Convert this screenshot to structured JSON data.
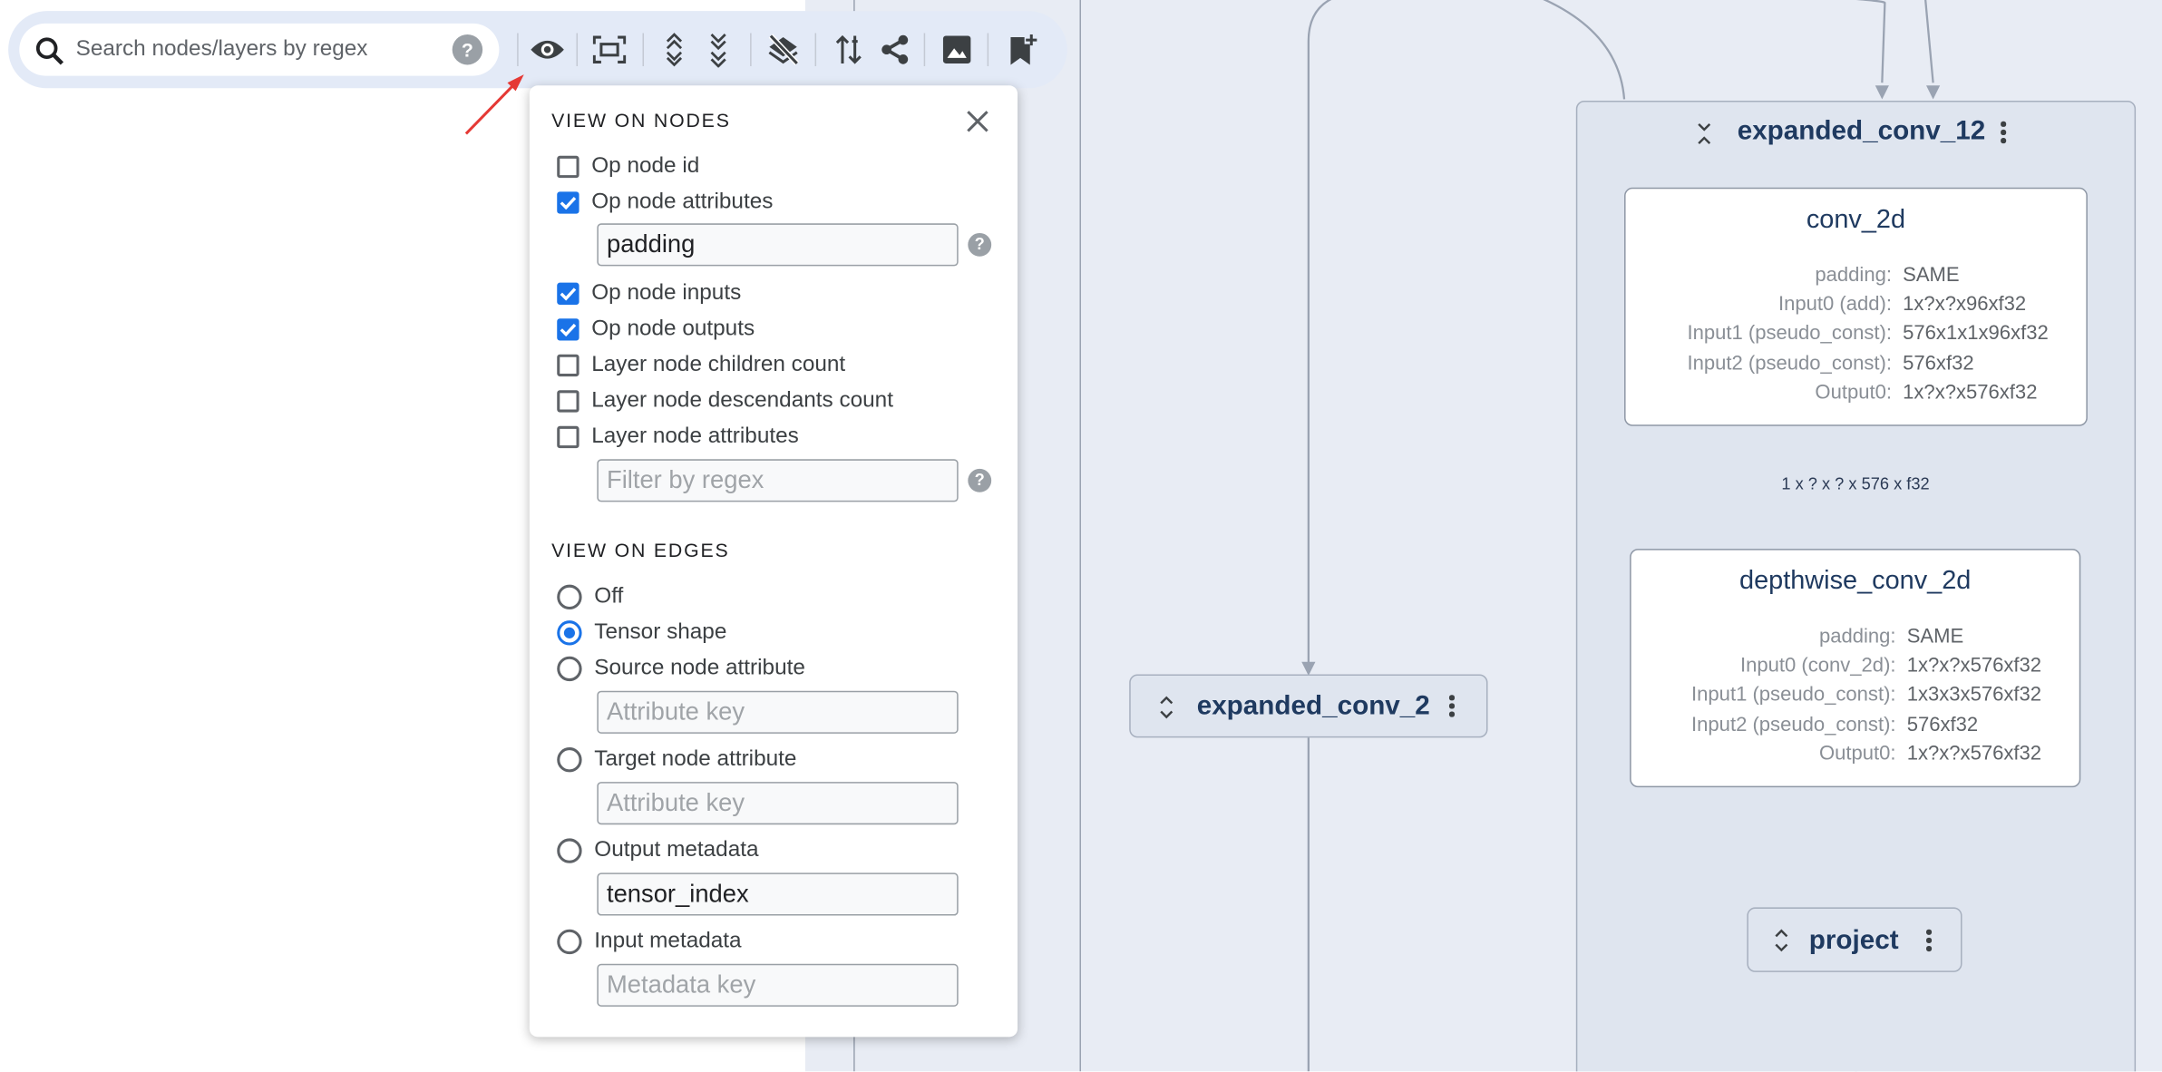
{
  "search": {
    "placeholder": "Search nodes/layers by regex",
    "help": "?"
  },
  "toolbar": {
    "icons": [
      "eye-icon",
      "fit-screen-icon",
      "expand-all-icon",
      "collapse-all-icon",
      "layers-off-icon",
      "sort-icon",
      "share-icon",
      "image-icon",
      "bookmark-add-icon"
    ]
  },
  "popup": {
    "nodes_heading": "VIEW ON NODES",
    "close": "×",
    "node_options": [
      {
        "label": "Op node id",
        "checked": false
      },
      {
        "label": "Op node attributes",
        "checked": true
      },
      {
        "label": "Op node inputs",
        "checked": true
      },
      {
        "label": "Op node outputs",
        "checked": true
      },
      {
        "label": "Layer node children count",
        "checked": false
      },
      {
        "label": "Layer node descendants count",
        "checked": false
      },
      {
        "label": "Layer node attributes",
        "checked": false
      }
    ],
    "op_attr_value": "padding",
    "layer_attr_placeholder": "Filter by regex",
    "help": "?",
    "edges_heading": "VIEW ON EDGES",
    "edge_options": [
      {
        "label": "Off",
        "selected": false
      },
      {
        "label": "Tensor shape",
        "selected": true
      },
      {
        "label": "Source node attribute",
        "selected": false
      },
      {
        "label": "Target node attribute",
        "selected": false
      },
      {
        "label": "Output metadata",
        "selected": false
      },
      {
        "label": "Input metadata",
        "selected": false
      }
    ],
    "source_attr_placeholder": "Attribute key",
    "target_attr_placeholder": "Attribute key",
    "output_metadata_value": "tensor_index",
    "input_metadata_placeholder": "Metadata key"
  },
  "graph": {
    "group_title": "expanded_conv_12",
    "conv": {
      "title": "conv_2d",
      "attrs": [
        {
          "k": "padding:",
          "v": "SAME"
        },
        {
          "k": "Input0 (add):",
          "v": "1x?x?x96xf32"
        },
        {
          "k": "Input1 (pseudo_const):",
          "v": "576x1x1x96xf32"
        },
        {
          "k": "Input2 (pseudo_const):",
          "v": "576xf32"
        },
        {
          "k": "Output0:",
          "v": "1x?x?x576xf32"
        }
      ]
    },
    "edge_label": "1 x ? x ? x 576 x f32",
    "depthwise": {
      "title": "depthwise_conv_2d",
      "attrs": [
        {
          "k": "padding:",
          "v": "SAME"
        },
        {
          "k": "Input0 (conv_2d):",
          "v": "1x?x?x576xf32"
        },
        {
          "k": "Input1 (pseudo_const):",
          "v": "1x3x3x576xf32"
        },
        {
          "k": "Input2 (pseudo_const):",
          "v": "576xf32"
        },
        {
          "k": "Output0:",
          "v": "1x?x?x576xf32"
        }
      ]
    },
    "expanded_conv_2": "expanded_conv_2",
    "project": "project"
  },
  "colors": {
    "accent": "#1a73e8",
    "annotation_arrow": "#e53935",
    "canvas": "#e8ecf4",
    "group_fill": "#dfe5ef"
  }
}
